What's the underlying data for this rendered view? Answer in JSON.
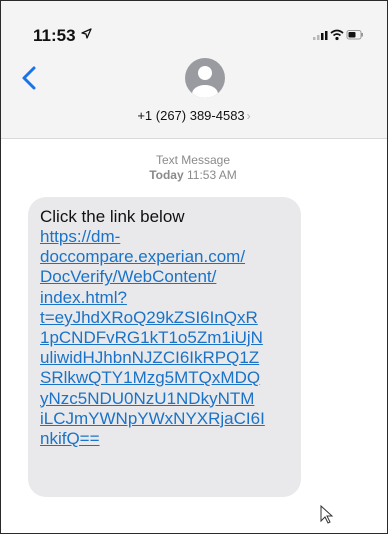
{
  "status_bar": {
    "time": "11:53",
    "location_icon": "location-arrow-icon",
    "signal_icon": "cellular-signal-icon",
    "wifi_icon": "wifi-icon",
    "battery_icon": "battery-icon"
  },
  "header": {
    "back_icon": "chevron-left-icon",
    "avatar_icon": "person-icon",
    "contact": "+1 (267) 389-4583",
    "contact_chevron": "›"
  },
  "thread": {
    "message_type": "Text Message",
    "day": "Today",
    "time": "11:53 AM"
  },
  "message": {
    "intro": "Click the link below",
    "link_lines": [
      "https://dm-",
      "doccompare.experian.com/",
      "DocVerify/WebContent/",
      "index.html?",
      "t=eyJhdXRoQ29kZSI6InQxR",
      "1pCNDFvRG1kT1o5Zm1iUjN",
      "uliwidHJhbnNJZCI6IkRPQ1Z",
      "SRlkwQTY1Mzg5MTQxMDQ",
      "yNzc5NDU0NzU1NDkyNTM",
      "iLCJmYWNpYWxNYXRjaCI6I",
      "nkifQ=="
    ]
  },
  "colors": {
    "link": "#1a73c8",
    "bubble": "#e9e9eb",
    "header_bg": "#f4f4f4",
    "ios_blue": "#1a73e8"
  }
}
